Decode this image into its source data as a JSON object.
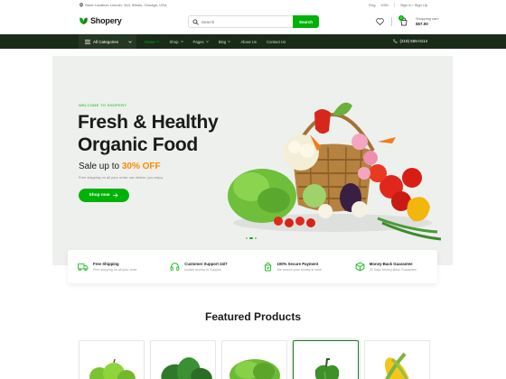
{
  "topbar": {
    "location": "Store Location: Lincoln- 344, Illinois, Chicago, USA",
    "language": "Eng",
    "currency": "USD",
    "sign_in": "Sign In / Sign Up"
  },
  "header": {
    "logo": "Shopery",
    "search_placeholder": "Search",
    "search_button": "Search",
    "cart_count": "0",
    "cart_label": "Shopping cart:",
    "cart_total": "$57.00"
  },
  "nav": {
    "all_categories": "All Categories",
    "items": [
      {
        "label": "Home",
        "active": true
      },
      {
        "label": "Shop"
      },
      {
        "label": "Pages"
      },
      {
        "label": "Blog"
      },
      {
        "label": "About Us"
      },
      {
        "label": "Contact Us"
      }
    ],
    "phone": "(219) 555-0114"
  },
  "hero": {
    "welcome": "WELCOME TO SHOPERY",
    "title_line1": "Fresh & Healthy",
    "title_line2": "Organic Food",
    "sale_prefix": "Sale up to",
    "sale_value": "30% OFF",
    "subtitle": "Free shipping on all your order. we deliver, you enjoy",
    "button": "Shop now"
  },
  "features": [
    {
      "title": "Free Shipping",
      "subtitle": "Free shipping on all your order",
      "icon": "truck-icon"
    },
    {
      "title": "Customer Support 24/7",
      "subtitle": "Instant access to Support",
      "icon": "headphones-icon"
    },
    {
      "title": "100% Secure Payment",
      "subtitle": "We ensure your money is save",
      "icon": "shopping-bag-icon"
    },
    {
      "title": "Money-Back Guarantee",
      "subtitle": "30 Days Money-Back Guarantee",
      "icon": "package-icon"
    }
  ],
  "featured": {
    "title": "Featured Products",
    "products": [
      "apples",
      "spinach",
      "lettuce",
      "green-pepper",
      "corn"
    ]
  },
  "colors": {
    "brand_green": "#00b207",
    "dark_nav": "#1a2b1a",
    "sale_orange": "#ff8a00"
  }
}
